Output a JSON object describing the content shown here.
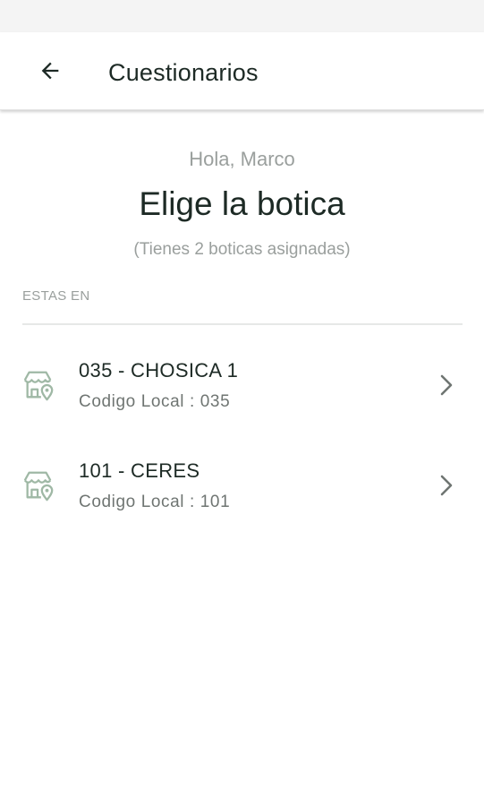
{
  "app_bar": {
    "title": "Cuestionarios"
  },
  "icons": {
    "back": "arrow-left-icon",
    "store": "store-location-icon",
    "chevron": "chevron-right-icon"
  },
  "colors": {
    "primary_text": "#1d2a25",
    "secondary_text": "#9a9f9d",
    "icon_accent": "#9fb8a5"
  },
  "main": {
    "greeting": "Hola, Marco",
    "heading": "Elige la botica",
    "assigned_text": "(Tienes 2 boticas asignadas)",
    "section_label": "ESTAS EN"
  },
  "stores": [
    {
      "name": "035 - CHOSICA 1",
      "code": "Codigo Local : 035"
    },
    {
      "name": "101 - CERES",
      "code": "Codigo Local : 101"
    }
  ]
}
